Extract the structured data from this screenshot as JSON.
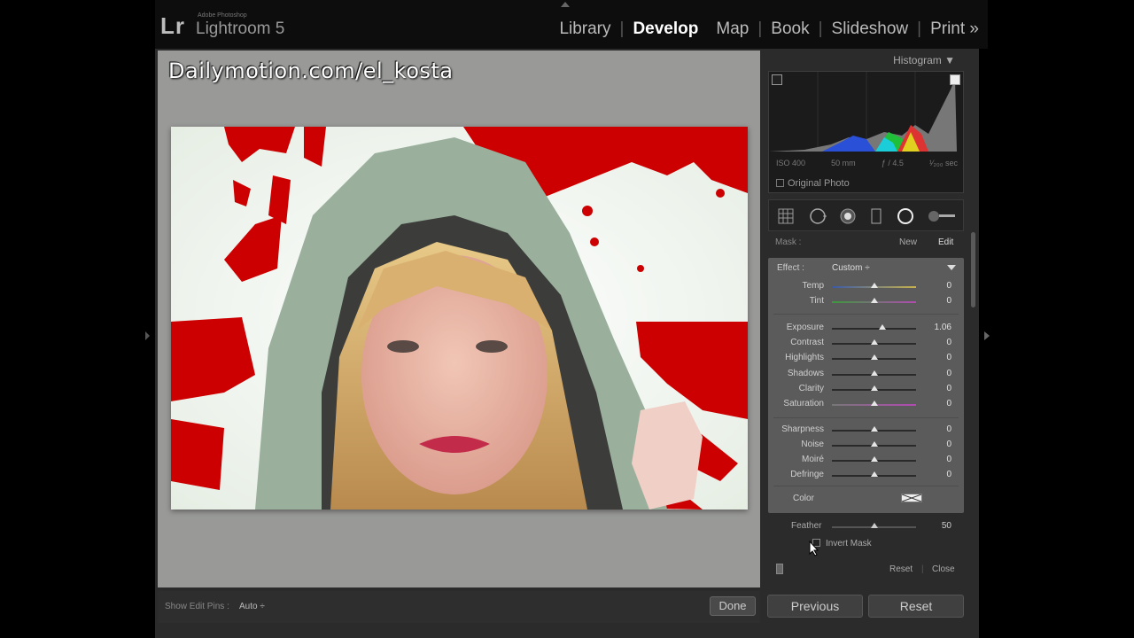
{
  "app": {
    "logo": "Lr",
    "vendor": "Adobe Photoshop",
    "product": "Lightroom 5"
  },
  "modules": [
    "Library",
    "Develop",
    "Map",
    "Book",
    "Slideshow",
    "Print »"
  ],
  "active_module": "Develop",
  "watermark": "Dailymotion.com/el_kosta",
  "toolbar": {
    "show_edit_pins_label": "Show Edit Pins :",
    "show_edit_pins_value": "Auto ÷",
    "done_label": "Done"
  },
  "histogram": {
    "title": "Histogram ▼",
    "iso": "ISO 400",
    "focal": "50 mm",
    "aperture": "ƒ / 4.5",
    "shutter": "¹⁄₂₀₀ sec",
    "original_photo": "Original Photo"
  },
  "mask": {
    "label": "Mask :",
    "new_label": "New",
    "edit_label": "Edit"
  },
  "effect": {
    "label": "Effect :",
    "value": "Custom ÷"
  },
  "sliders": [
    {
      "name": "Temp",
      "value": "0",
      "pos": 0.5
    },
    {
      "name": "Tint",
      "value": "0",
      "pos": 0.5
    },
    {
      "name": "Exposure",
      "value": "1.06",
      "pos": 0.6
    },
    {
      "name": "Contrast",
      "value": "0",
      "pos": 0.5
    },
    {
      "name": "Highlights",
      "value": "0",
      "pos": 0.5
    },
    {
      "name": "Shadows",
      "value": "0",
      "pos": 0.5
    },
    {
      "name": "Clarity",
      "value": "0",
      "pos": 0.5
    },
    {
      "name": "Saturation",
      "value": "0",
      "pos": 0.5
    },
    {
      "name": "Sharpness",
      "value": "0",
      "pos": 0.5
    },
    {
      "name": "Noise",
      "value": "0",
      "pos": 0.5
    },
    {
      "name": "Moiré",
      "value": "0",
      "pos": 0.5
    },
    {
      "name": "Defringe",
      "value": "0",
      "pos": 0.5
    }
  ],
  "color": {
    "label": "Color"
  },
  "feather": {
    "label": "Feather",
    "value": "50"
  },
  "invert_mask": "Invert Mask",
  "panel_footer": {
    "reset_label": "Reset",
    "close_label": "Close"
  },
  "bottom_buttons": {
    "previous_label": "Previous",
    "reset_label": "Reset"
  },
  "colors": {
    "mask_overlay": "#cc0000",
    "panel_bg": "#2b2b2b",
    "canvas_bg": "#999a98"
  }
}
